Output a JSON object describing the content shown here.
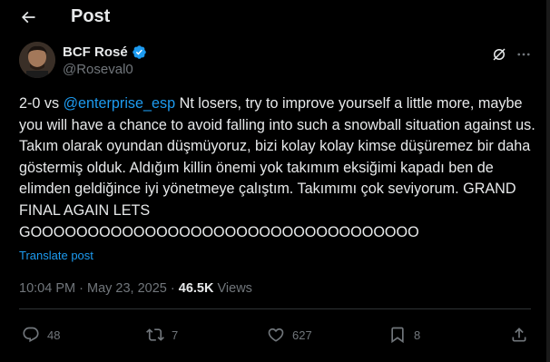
{
  "header": {
    "title": "Post"
  },
  "author": {
    "name": "BCF Rosé",
    "handle": "@Roseval0"
  },
  "post": {
    "prefix": "2-0 vs ",
    "mention": "@enterprise_esp",
    "body": " Nt losers, try to improve yourself a little more, maybe you will have a chance to avoid falling into such a snowball situation against us. Takım olarak oyundan düşmüyoruz, bizi kolay kolay kimse düşüremez bir daha göstermiş olduk. Aldığım killin önemi yok takımım eksiğimi kapadı ben de elimden geldiğince iyi yönetmeye çalıştım. Takımımı çok seviyorum. GRAND FINAL AGAIN LETS GOOOOOOOOOOOOOOOOOOOOOOOOOOOOOOOOOO",
    "translate_label": "Translate post"
  },
  "meta": {
    "time": "10:04 PM",
    "date": "May 23, 2025",
    "views_count": "46.5K",
    "views_label": "Views",
    "separator": "·"
  },
  "actions": {
    "replies": "48",
    "reposts": "7",
    "likes": "627",
    "bookmarks": "8"
  },
  "colors": {
    "accent": "#1d9bf0",
    "muted": "#71767b",
    "text": "#e7e9ea",
    "background": "#000000"
  }
}
